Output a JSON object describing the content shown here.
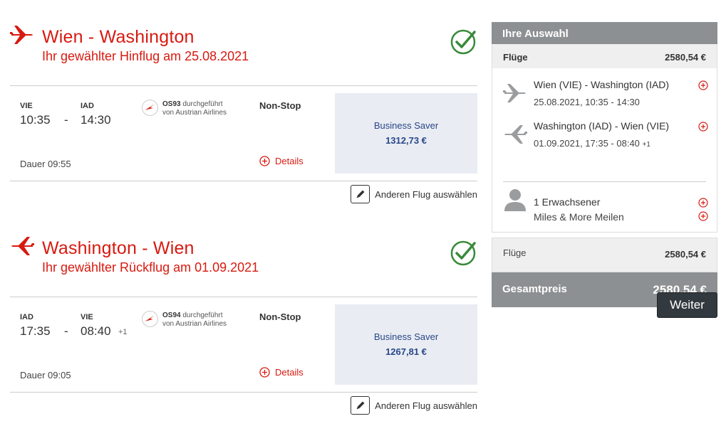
{
  "outbound": {
    "title": "Wien - Washington",
    "subtitle": "Ihr gewählter Hinflug am 25.08.2021",
    "dep_airport": "VIE",
    "arr_airport": "IAD",
    "dep_time": "10:35",
    "separator": "-",
    "arr_time": "14:30",
    "flight_no": "OS93",
    "operated_by": "durchgeführt",
    "airline": "von Austrian Airlines",
    "stops": "Non-Stop",
    "duration": "Dauer 09:55",
    "details": "Details",
    "fare_name": "Business Saver",
    "fare_price": "1312,73 €",
    "change_label": "Anderen Flug auswählen"
  },
  "inbound": {
    "title": "Washington - Wien",
    "subtitle": "Ihr gewählter Rückflug am 01.09.2021",
    "dep_airport": "IAD",
    "arr_airport": "VIE",
    "dep_time": "17:35",
    "separator": "-",
    "arr_time": "08:40",
    "day_offset": "+1",
    "flight_no": "OS94",
    "operated_by": "durchgeführt",
    "airline": "von Austrian Airlines",
    "stops": "Non-Stop",
    "duration": "Dauer 09:05",
    "details": "Details",
    "fare_name": "Business Saver",
    "fare_price": "1267,81 €",
    "change_label": "Anderen Flug auswählen"
  },
  "summary": {
    "header": "Ihre Auswahl",
    "flights_label": "Flüge",
    "flights_total": "2580,54 €",
    "out_route": "Wien (VIE) - Washington (IAD)",
    "out_date": "25.08.2021, 10:35 - 14:30",
    "in_route": "Washington (IAD) - Wien (VIE)",
    "in_date": "01.09.2021, 17:35 - 08:40",
    "in_day_offset": "+1",
    "passengers": "1 Erwachsener",
    "miles": "Miles & More Meilen",
    "sub_label": "Flüge",
    "sub_value": "2580,54 €",
    "total_label": "Gesamtpreis",
    "total_value": "2580,54 €"
  },
  "next_button": "Weiter",
  "colors": {
    "brand_red": "#d71a10",
    "check_green": "#3a8a3a",
    "fare_blue": "#28478a",
    "summary_grey": "#8d9092"
  }
}
